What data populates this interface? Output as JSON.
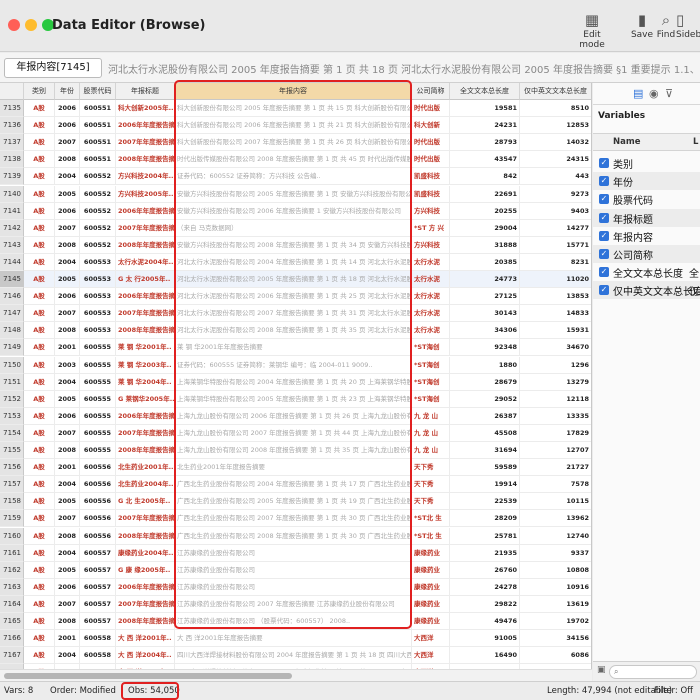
{
  "window": {
    "title": "Data Editor (Browse)"
  },
  "toolbar": {
    "edit_mode": "Edit mode",
    "save": "Save",
    "find": "Find",
    "sidebar": "Sideb"
  },
  "command": {
    "varname": "年报内容[7145]",
    "cell_value": "河北太行水泥股份有限公司 2005 年度报告摘要 第 1 页 共 18 页 河北太行水泥股份有限公司 2005 年度报告摘要 §1 重要提示  1.1、本公司董事会、监事会及董事、监事、高级"
  },
  "columns": [
    "类别",
    "年份",
    "股票代码",
    "年报标题",
    "年报内容",
    "公司简称",
    "全文文本总长度",
    "仅中英文文本总长度"
  ],
  "rows": [
    [
      "7135",
      "A股",
      "2006",
      "600551",
      "科大创新2005年..",
      "科大创新股份有限公司 2005 年度报告摘要 第 1 页 共 15 页 科大创新股份有限公司",
      "时代出版",
      "19581",
      "8510"
    ],
    [
      "7136",
      "A股",
      "2006",
      "600551",
      "2006年年度报告摘要",
      "科大创新股份有限公司 2006 年度报告摘要 第 1 页 共 21 页 科大创新股份有限公司",
      "科大创新",
      "24231",
      "12853"
    ],
    [
      "7137",
      "A股",
      "2007",
      "600551",
      "2007年年度报告摘要",
      "科大创新股份有限公司 2007 年度报告摘要 第 1 页 共 26 页 科大创新股份有限公司",
      "时代出版",
      "28793",
      "14032"
    ],
    [
      "7138",
      "A股",
      "2008",
      "600551",
      "2008年年度报告摘要",
      "时代出版传媒股份有限公司 2008 年度报告摘要 第 1 页 共 45 页 时代出版传媒股份",
      "时代出版",
      "43547",
      "24315"
    ],
    [
      "7139",
      "A股",
      "2004",
      "600552",
      "方兴科技2004年..",
      "证券代码：600552          证券简称：方兴科技          公告编..",
      "凯盛科技",
      "842",
      "443"
    ],
    [
      "7140",
      "A股",
      "2005",
      "600552",
      "方兴科技2005年..",
      "安徽方兴科技股份有限公司 2005 年度报告摘要 第 1 页 安徽方兴科技股份有限公司",
      "凯盛科技",
      "22691",
      "9273"
    ],
    [
      "7141",
      "A股",
      "2006",
      "600552",
      "2006年年度报告摘要",
      "安徽方兴科技股份有限公司 2006 年度报告摘要 1 安徽方兴科技股份有限公司",
      "方兴科技",
      "20255",
      "9403"
    ],
    [
      "7142",
      "A股",
      "2007",
      "600552",
      "2007年年度报告摘要",
      "（来自 马克数据网）",
      "*ST 方 兴",
      "29004",
      "14277"
    ],
    [
      "7143",
      "A股",
      "2008",
      "600552",
      "2008年年度报告摘要",
      "安徽方兴科技股份有限公司 2008 年度报告摘要 第 1 页 共 34 页 安徽方兴科技股份",
      "方兴科技",
      "31888",
      "15771"
    ],
    [
      "7144",
      "A股",
      "2004",
      "600553",
      "太行水泥2004年..",
      "河北太行水泥股份有限公司 2004 年度报告摘要 第 1 页 共 14 页 河北太行水泥股份",
      "太行水泥",
      "20385",
      "8231"
    ],
    [
      "7145",
      "A股",
      "2005",
      "600553",
      "G 太 行2005年..",
      "河北太行水泥股份有限公司 2005 年度报告摘要 第 1 页 共 18 页 河北太行水泥股份",
      "太行水泥",
      "24773",
      "11020"
    ],
    [
      "7146",
      "A股",
      "2006",
      "600553",
      "2006年年度报告摘要",
      "河北太行水泥股份有限公司 2006 年度报告摘要 第 1 页 共 25 页 河北太行水泥股份",
      "太行水泥",
      "27125",
      "13853"
    ],
    [
      "7147",
      "A股",
      "2007",
      "600553",
      "2007年年度报告摘要",
      "河北太行水泥股份有限公司 2007 年度报告摘要 第 1 页 共 31 页 河北太行水泥股份",
      "太行水泥",
      "30143",
      "14833"
    ],
    [
      "7148",
      "A股",
      "2008",
      "600553",
      "2008年年度报告摘要",
      "河北太行水泥股份有限公司 2008 年度报告摘要 第 1 页 共 35 页 河北太行水泥股份",
      "太行水泥",
      "34306",
      "15931"
    ],
    [
      "7149",
      "A股",
      "2001",
      "600555",
      "莱 钢 华2001年..",
      "莱 钢 华2001年年度报告摘要",
      "*ST海创",
      "92348",
      "34670"
    ],
    [
      "7150",
      "A股",
      "2003",
      "600555",
      "莱 钢 华2003年..",
      "证券代码：600555      证券简称：莱钢华      编号：临 2004-011      9009..",
      "*ST海创",
      "1880",
      "1296"
    ],
    [
      "7151",
      "A股",
      "2004",
      "600555",
      "莱 钢 华2004年..",
      "上海莱钢华特股份有限公司 2004 年度报告摘要 第 1 页 共 20 页 上海莱钢华特股份",
      "*ST海创",
      "28679",
      "13279"
    ],
    [
      "7152",
      "A股",
      "2005",
      "600555",
      "G 莱钢华2005年..",
      "上海莱钢华特股份有限公司 2005 年度报告摘要 第 1 页 共 23 页 上海莱钢华特股份",
      "*ST海创",
      "29052",
      "12118"
    ],
    [
      "7153",
      "A股",
      "2006",
      "600555",
      "2006年年度报告摘要",
      "上海九龙山股份有限公司 2006 年度报告摘要 第 1 页 共 26 页 上海九龙山股份有限公司",
      "九 龙 山",
      "26387",
      "13335"
    ],
    [
      "7154",
      "A股",
      "2007",
      "600555",
      "2007年年度报告摘要",
      "上海九龙山股份有限公司 2007 年度报告摘要 第 1 页 共 44 页 上海九龙山股份有限公司",
      "九 龙 山",
      "45508",
      "17829"
    ],
    [
      "7155",
      "A股",
      "2008",
      "600555",
      "2008年年度报告摘要",
      "上海九龙山股份有限公司 2008 年度报告摘要 第 1 页 共 35 页 上海九龙山股份有限公司",
      "九 龙 山",
      "31694",
      "12707"
    ],
    [
      "7156",
      "A股",
      "2001",
      "600556",
      "北生药业2001年..",
      "北生药业2001年年度报告摘要",
      "天下秀",
      "59589",
      "21727"
    ],
    [
      "7157",
      "A股",
      "2004",
      "600556",
      "北生药业2004年..",
      "广西北生药业股份有限公司 2004 年度报告摘要 第 1 页 共 17 页 广西北生药业股份",
      "天下秀",
      "19914",
      "7578"
    ],
    [
      "7158",
      "A股",
      "2005",
      "600556",
      "G 北 生2005年..",
      "广西北生药业股份有限公司 2005 年度报告摘要 第 1 页 共 19 页 广西北生药业股份",
      "天下秀",
      "22539",
      "10115"
    ],
    [
      "7159",
      "A股",
      "2007",
      "600556",
      "2007年年度报告摘要",
      "广西北生药业股份有限公司 2007 年度报告摘要 第 1 页 共 30 页 广西北生药业股份",
      "*ST北 生",
      "28209",
      "13962"
    ],
    [
      "7160",
      "A股",
      "2008",
      "600556",
      "2008年年度报告摘要",
      "广西北生药业股份有限公司 2008 年度报告摘要 第 1 页 共 30 页 广西北生药业股份",
      "*ST北 生",
      "25781",
      "12740"
    ],
    [
      "7161",
      "A股",
      "2004",
      "600557",
      "康缘药业2004年..",
      "江苏康缘药业股份有限公司",
      "康缘药业",
      "21935",
      "9337"
    ],
    [
      "7162",
      "A股",
      "2005",
      "600557",
      "G 康 缘2005年..",
      "江苏康缘药业股份有限公司",
      "康缘药业",
      "26760",
      "10808"
    ],
    [
      "7163",
      "A股",
      "2006",
      "600557",
      "2006年年度报告摘要",
      "江苏康缘药业股份有限公司",
      "康缘药业",
      "24278",
      "10916"
    ],
    [
      "7164",
      "A股",
      "2007",
      "600557",
      "2007年年度报告摘要",
      "江苏康缘药业股份有限公司    2007 年度报告摘要 江苏康缘药业股份有限公司",
      "康缘药业",
      "29822",
      "13619"
    ],
    [
      "7165",
      "A股",
      "2008",
      "600557",
      "2008年年度报告摘要",
      "江苏康缘药业股份有限公司    （股票代码：600557）    2008..",
      "康缘药业",
      "49476",
      "19702"
    ],
    [
      "7166",
      "A股",
      "2001",
      "600558",
      "大 西 洋2001年..",
      "大 西 洋2001年年度报告摘要",
      "大西洋",
      "91005",
      "34156"
    ],
    [
      "7167",
      "A股",
      "2004",
      "600558",
      "大 西 洋2004年..",
      "四川大西洋焊接材料股份有限公司 2004 年度报告摘要 第 1 页 共 18 页 四川大西洋",
      "大西洋",
      "16490",
      "6086"
    ],
    [
      "7168",
      "A股",
      "2005",
      "600558",
      "大 西 洋2005年..",
      "四川大西洋焊接材料股份有限公司 2005 年度报告摘要 第 1 页 共 23 页 四川大西洋",
      "大西洋",
      "22961",
      "10061"
    ]
  ],
  "current_row": "7145",
  "variables_panel": {
    "title": "Variables",
    "col_name": "Name",
    "col_label": "L",
    "items": [
      {
        "name": "类别",
        "label": ""
      },
      {
        "name": "年份",
        "label": ""
      },
      {
        "name": "股票代码",
        "label": ""
      },
      {
        "name": "年报标题",
        "label": ""
      },
      {
        "name": "年报内容",
        "label": ""
      },
      {
        "name": "公司简称",
        "label": ""
      },
      {
        "name": "全文文本总长度",
        "label": "全"
      },
      {
        "name": "仅中英文文本总长度",
        "label": "仅"
      }
    ]
  },
  "status": {
    "vars": "Vars: 8",
    "order": "Order: Modified",
    "obs": "Obs: 54,050",
    "length": "Length: 47,994 (not editable)",
    "filter": "Filter: Off"
  },
  "colors": {
    "accent": "#2f73d9",
    "highlight": "#e02020",
    "selected_header": "#f3d9a8"
  }
}
